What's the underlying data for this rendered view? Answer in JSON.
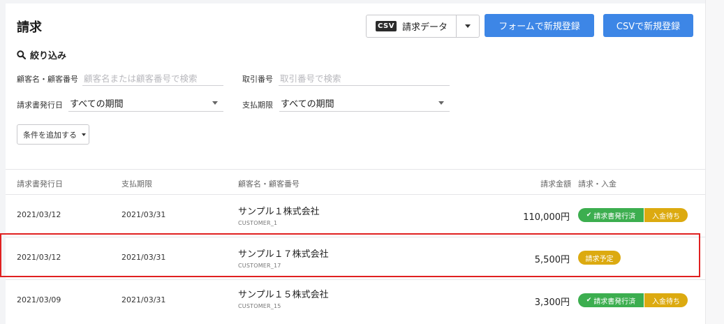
{
  "page": {
    "title": "請求"
  },
  "toolbar": {
    "csv_badge": "CSV",
    "csv_label": "請求データ",
    "form_button": "フォームで新規登録",
    "csv_button": "CSVで新規登録"
  },
  "filter": {
    "heading": "絞り込み",
    "customer_label": "顧客名・顧客番号",
    "customer_placeholder": "顧客名または顧客番号で検索",
    "deal_label": "取引番号",
    "deal_placeholder": "取引番号で検索",
    "issue_date_label": "請求書発行日",
    "issue_date_value": "すべての期間",
    "due_label": "支払期限",
    "due_value": "すべての期間",
    "add_condition": "条件を追加する"
  },
  "table": {
    "headers": {
      "issue_date": "請求書発行日",
      "due_date": "支払期限",
      "customer": "顧客名・顧客番号",
      "amount": "請求金額",
      "status": "請求・入金"
    },
    "rows": [
      {
        "issue_date": "2021/03/12",
        "due_date": "2021/03/31",
        "customer_name": "サンプル１株式会社",
        "customer_code": "CUSTOMER_1",
        "amount": "110,000円",
        "status1": "請求書発行済",
        "status2": "入金待ち"
      },
      {
        "issue_date": "2021/03/12",
        "due_date": "2021/03/31",
        "customer_name": "サンプル１７株式会社",
        "customer_code": "CUSTOMER_17",
        "amount": "5,500円",
        "status1": "請求予定"
      },
      {
        "issue_date": "2021/03/09",
        "due_date": "2021/03/31",
        "customer_name": "サンプル１５株式会社",
        "customer_code": "CUSTOMER_15",
        "amount": "3,300円",
        "status1": "請求書発行済",
        "status2": "入金待ち"
      }
    ]
  },
  "colors": {
    "primary": "#3d86e6",
    "success": "#3cae4f",
    "warning": "#dcaa10",
    "highlight": "#e02020"
  }
}
